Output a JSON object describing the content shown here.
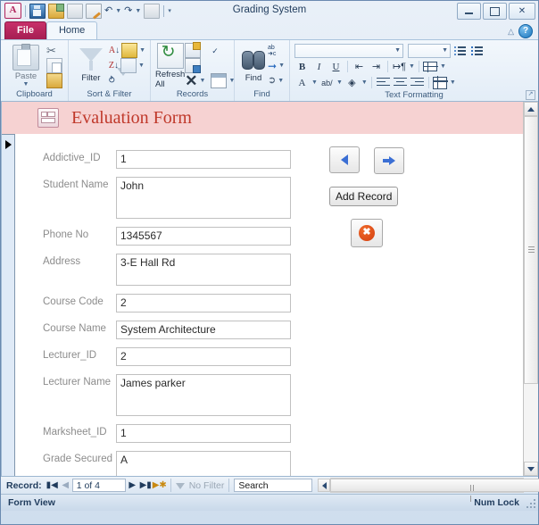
{
  "window": {
    "title": "Grading System",
    "minimize_label": "Minimize",
    "restore_label": "Restore",
    "close_label": "✕"
  },
  "quick_access": {
    "app_logo": "A",
    "items": [
      {
        "name": "save-icon",
        "label": "Save"
      },
      {
        "name": "lock-field-icon",
        "label": "Lock"
      },
      {
        "name": "print-preview-icon",
        "label": "Print Preview"
      },
      {
        "name": "edit-icon",
        "label": "Edit"
      },
      {
        "name": "undo-icon",
        "label": "↶"
      },
      {
        "name": "redo-icon",
        "label": "↷"
      },
      {
        "name": "refresh-all-icon",
        "label": "Refresh"
      },
      {
        "name": "customize-qat-icon",
        "label": "☷"
      }
    ]
  },
  "ribbon": {
    "tabs": [
      {
        "label": "File",
        "active": false
      },
      {
        "label": "Home",
        "active": true
      }
    ],
    "help_label": "?",
    "collapse_label": "⌃",
    "groups": [
      {
        "label": "Clipboard",
        "big_button": "Paste",
        "small_buttons": [
          "Cut",
          "Copy",
          "Format Painter"
        ]
      },
      {
        "label": "Sort & Filter",
        "big_button": "Filter",
        "small_buttons": [
          "Ascending",
          "Descending",
          "Remove Sort",
          "Advanced",
          "Toggle Filter"
        ]
      },
      {
        "label": "Records",
        "big_button": "Refresh All",
        "small_buttons": [
          "New",
          "Save",
          "Delete",
          "Totals",
          "Spelling",
          "More"
        ]
      },
      {
        "label": "Find",
        "big_button": "Find",
        "small_buttons": [
          "Replace",
          "Go To",
          "Select"
        ]
      },
      {
        "label": "Text Formatting",
        "font_name": "",
        "font_size": "",
        "buttons": [
          "B",
          "I",
          "U"
        ]
      }
    ]
  },
  "form": {
    "header_title": "Evaluation Form",
    "header_icon": "form-icon",
    "fields": [
      {
        "label": "Addictive_ID",
        "value": "1",
        "size": "h1"
      },
      {
        "label": "Student Name",
        "value": "John",
        "size": "h2"
      },
      {
        "label": "Phone No",
        "value": "1345567",
        "size": "h1"
      },
      {
        "label": "Address",
        "value": "3-E Hall Rd",
        "size": "h3"
      },
      {
        "label": "Course Code",
        "value": "2",
        "size": "h1"
      },
      {
        "label": "Course Name",
        "value": "System Architecture",
        "size": "h1"
      },
      {
        "label": "Lecturer_ID",
        "value": "2",
        "size": "h1"
      },
      {
        "label": "Lecturer Name",
        "value": "James parker",
        "size": "h2"
      },
      {
        "label": "Marksheet_ID",
        "value": "1",
        "size": "h1"
      },
      {
        "label": "Grade Secured",
        "value": "A",
        "size": "h2"
      }
    ],
    "buttons": {
      "previous": "previous-record-button",
      "next": "next-record-button",
      "add_record": "Add Record",
      "delete": "delete-record-button"
    }
  },
  "record_nav": {
    "label": "Record:",
    "first": "◀│",
    "previous": "◀",
    "position": "1 of 4",
    "next": "▶",
    "last": "│▶",
    "new": "▶✱",
    "filter_status": "No Filter",
    "search_value": "Search"
  },
  "status_bar": {
    "view": "Form View",
    "num_lock": "Num Lock"
  },
  "colors": {
    "accent_pink": "#f6d2d2",
    "title_red": "#c0392b",
    "file_tab": "#c8306a",
    "delete_orange": "#d33f10",
    "nav_blue": "#3b6fd4"
  }
}
